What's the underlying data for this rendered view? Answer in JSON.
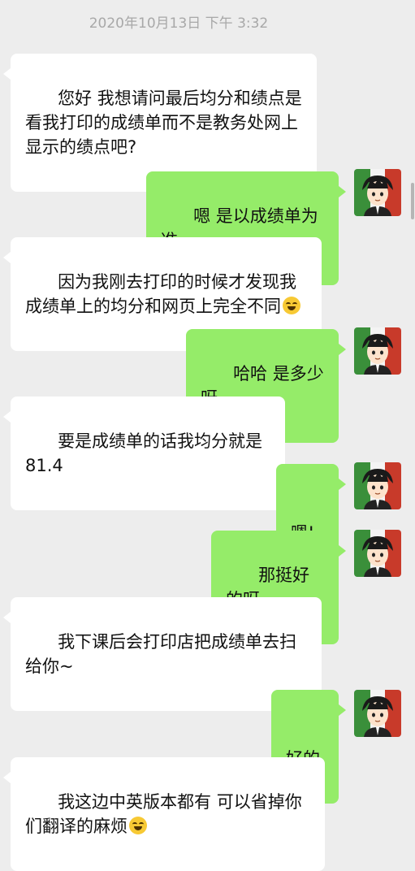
{
  "header": {
    "timestamp": "2020年10月13日 下午 3:32"
  },
  "messages": [
    {
      "side": "left",
      "text": "您好 我想请问最后均分和绩点是看我打印的成绩单而不是教务处网上显示的绩点吧?"
    },
    {
      "side": "right",
      "text": "嗯 是以成绩单为准"
    },
    {
      "side": "left",
      "text": "因为我刚去打印的时候才发现我成绩单上的均分和网页上完全不同",
      "emoji": "laughing-crying"
    },
    {
      "side": "right",
      "text": "哈哈 是多少呀"
    },
    {
      "side": "left",
      "text": "要是成绩单的话我均分就是 81.4"
    },
    {
      "side": "right",
      "text": "嗯!"
    },
    {
      "side": "right",
      "text": "那挺好的呀"
    },
    {
      "side": "left",
      "text": "我下课后会打印店把成绩单去扫给你~"
    },
    {
      "side": "right",
      "text": "好的"
    },
    {
      "side": "left",
      "text": "我这边中英版本都有 可以省掉你们翻译的麻烦",
      "emoji": "grinning-squint"
    }
  ],
  "colors": {
    "background": "#ededed",
    "bubble_self": "#95ec69",
    "bubble_other": "#ffffff",
    "timestamp": "#a8a8a8"
  },
  "icons": {
    "avatar": "user-avatar-icon",
    "emoji_1": "laughing-crying-emoji-icon",
    "emoji_2": "grinning-squint-emoji-icon"
  }
}
